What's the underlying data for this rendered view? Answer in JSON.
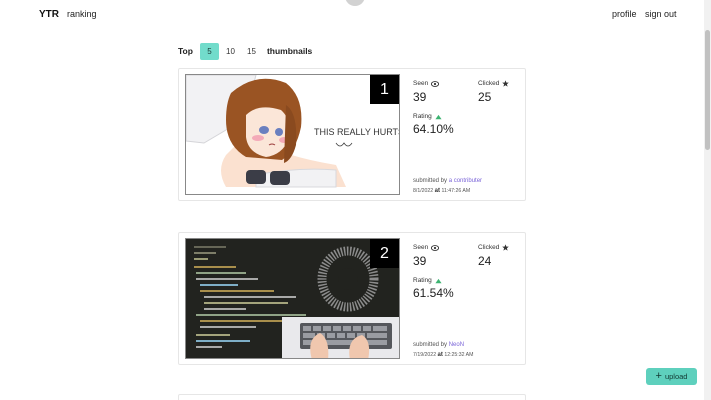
{
  "nav": {
    "brand": "YTR",
    "ranking": "ranking",
    "profile": "profile",
    "signout": "sign out"
  },
  "top": {
    "label": "Top",
    "options": [
      "5",
      "10",
      "15"
    ],
    "selected": "5",
    "suffix": "thumbnails"
  },
  "labels": {
    "seen": "Seen",
    "clicked": "Clicked",
    "rating": "Rating",
    "submitted_by": "submitted by",
    "at": "at"
  },
  "cards": [
    {
      "rank": "1",
      "seen": "39",
      "clicked": "25",
      "rating": "64.10%",
      "submitter": "a contributer",
      "date": "8/1/2022",
      "time": "11:47:26 AM",
      "thumb_text": "THIS REALLY HURTS"
    },
    {
      "rank": "2",
      "seen": "39",
      "clicked": "24",
      "rating": "61.54%",
      "submitter": "NeoN",
      "date": "7/19/2022",
      "time": "12:25:32 AM"
    }
  ],
  "upload": {
    "label": "upload"
  },
  "colors": {
    "accent": "#72dccb",
    "rating_up": "#3cb371",
    "submitter_link": "#7a64d8"
  }
}
